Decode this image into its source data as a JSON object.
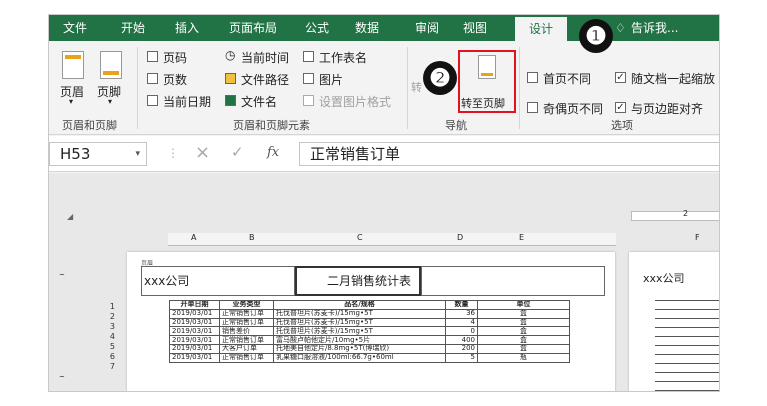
{
  "tabs": [
    "文件",
    "开始",
    "插入",
    "页面布局",
    "公式",
    "数据",
    "审阅",
    "视图",
    "设计"
  ],
  "tell_me": "告诉我...",
  "ribbon": {
    "header_btn": "页眉",
    "footer_btn": "页脚",
    "group1_label": "页眉和页脚",
    "elements": {
      "page_number": "页码",
      "page_count": "页数",
      "current_date": "当前日期",
      "current_time": "当前时间",
      "file_path": "文件路径",
      "file_name": "文件名",
      "sheet_name": "工作表名",
      "picture": "图片",
      "format_picture": "设置图片格式"
    },
    "group2_label": "页眉和页脚元素",
    "goto_header_partial": "转",
    "goto_footer": "转至页脚",
    "group3_label": "导航",
    "options": {
      "different_first": "首页不同",
      "different_odd_even": "奇偶页不同",
      "scale_with_doc": "随文档一起缩放",
      "align_margins": "与页边距对齐"
    },
    "group4_label": "选项",
    "check_different_first": "",
    "check_different_odd_even": "",
    "check_scale_with_doc": "✓",
    "check_align_margins": "✓"
  },
  "formula_bar": {
    "cell_ref": "H53",
    "cancel": "×",
    "enter": "✓",
    "fx": "fx",
    "content": "正常销售订单"
  },
  "sheet": {
    "col_headers": [
      "A",
      "B",
      "C",
      "D",
      "E",
      "F"
    ],
    "ruler_mark": "2",
    "header_tag": "页眉",
    "company": "xxx公司",
    "title": "二月销售统计表",
    "company_page2": "xxx公司",
    "columns": [
      "开单日期",
      "业务类型",
      "品名/规格",
      "数量",
      "单位"
    ],
    "rows": [
      {
        "n": "1"
      },
      {
        "n": "2",
        "date": "2019/03/01",
        "type": "正常销售订单",
        "name": "托伐普坦片(苏麦卡)/15mg•5T",
        "qty": "36",
        "unit": "盒"
      },
      {
        "n": "3",
        "date": "2019/03/01",
        "type": "正常销售订单",
        "name": "托伐普坦片(苏麦卡)/15mg•5T",
        "qty": "4",
        "unit": "盒"
      },
      {
        "n": "4",
        "date": "2019/03/01",
        "type": "销售差价",
        "name": "托伐普坦片(苏麦卡)/15mg•5T",
        "qty": "0",
        "unit": "盒"
      },
      {
        "n": "5",
        "date": "2019/03/01",
        "type": "正常销售订单",
        "name": "富马酸卢帕他定片/10mg•5片",
        "qty": "400",
        "unit": "盒"
      },
      {
        "n": "6",
        "date": "2019/03/01",
        "type": "大客户订单",
        "name": "托地美自他定片/8.8mg•5T(博瑞欣)",
        "qty": "200",
        "unit": "盒"
      },
      {
        "n": "7",
        "date": "2019/03/01",
        "type": "正常销售订单",
        "name": "乳果糖口服溶液/100ml:66.7g•60ml",
        "qty": "5",
        "unit": "瓶"
      }
    ]
  },
  "callouts": [
    "❶",
    "❷"
  ],
  "colors": {
    "brand": "#217346",
    "highlight": "#e0141e"
  }
}
